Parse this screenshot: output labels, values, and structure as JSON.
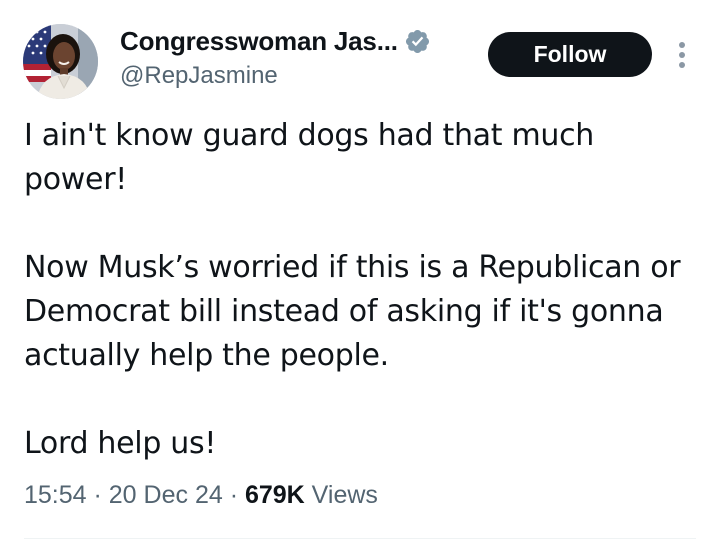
{
  "author": {
    "display_name": "Congresswoman Jas...",
    "handle": "@RepJasmine",
    "verified_icon": "verified-badge-icon",
    "avatar_icon": "profile-photo"
  },
  "actions": {
    "follow_label": "Follow",
    "more_icon": "more-vertical-icon"
  },
  "tweet": {
    "paragraphs": [
      "I ain't know guard dogs had that much power!",
      "Now Musk’s worried if this is a Republican or Democrat bill instead of asking if it's gonna actually help the people.",
      "Lord help us!"
    ]
  },
  "meta": {
    "time": "15:54",
    "separator": " · ",
    "date": "20 Dec 24",
    "views_count": "679K",
    "views_label": " Views"
  },
  "colors": {
    "text_primary": "#0f1419",
    "text_secondary": "#536471",
    "follow_bg": "#0f1419",
    "verified_badge": "#829aab"
  }
}
